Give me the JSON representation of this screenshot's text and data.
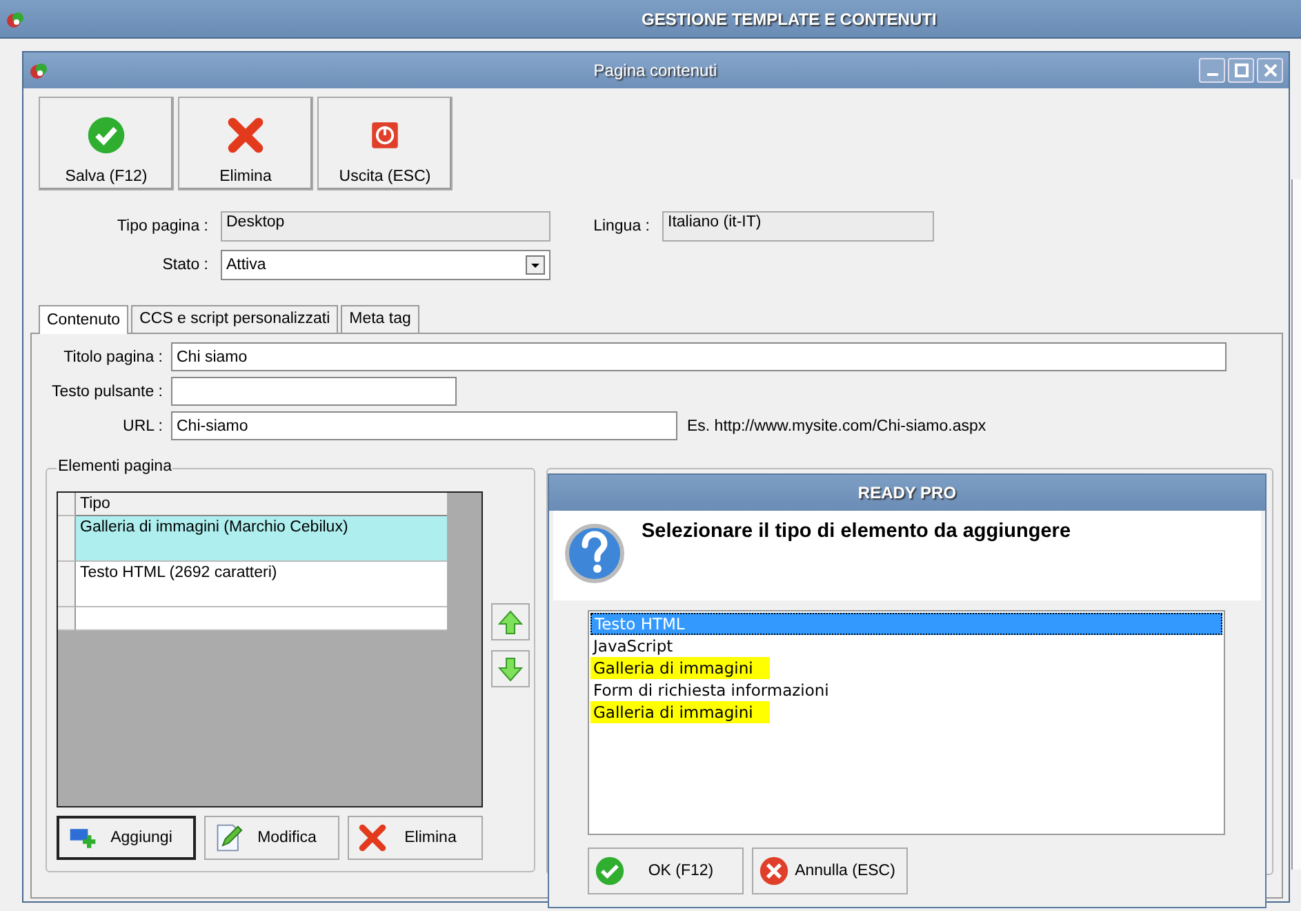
{
  "app_window": {
    "title": "GESTIONE TEMPLATE E CONTENUTI"
  },
  "window": {
    "title": "Pagina contenuti"
  },
  "toolbar": [
    {
      "label": "Salva (F12)",
      "kind": "save"
    },
    {
      "label": "Elimina",
      "kind": "delete"
    },
    {
      "label": "Uscita (ESC)",
      "kind": "exit"
    }
  ],
  "header_fields": [
    {
      "label": "Tipo pagina :",
      "value": "Desktop",
      "kind": "readonly"
    },
    {
      "label": "Lingua :",
      "value": "Italiano (it-IT)",
      "kind": "readonly"
    },
    {
      "label": "Stato :",
      "value": "Attiva",
      "kind": "select"
    }
  ],
  "tabs": [
    {
      "label": "Contenuto",
      "selected": true
    },
    {
      "label": "CCS e script personalizzati",
      "selected": false
    },
    {
      "label": "Meta tag",
      "selected": false
    }
  ],
  "content_fields": [
    {
      "label": "Titolo pagina :",
      "value": "Chi siamo"
    },
    {
      "label": "Testo pulsante :"
    },
    {
      "label": "URL :",
      "value": "Chi-siamo",
      "hint": "Es. http://www.mysite.com/Chi-siamo.aspx"
    }
  ],
  "elements_group": {
    "title": "Elementi pagina",
    "columns": [
      "Tipo"
    ],
    "rows": [
      {
        "text": "Galleria di immagini (Marchio Cebilux)",
        "selected": true
      },
      {
        "text": "Testo HTML (2692 caratteri)",
        "selected": false
      }
    ],
    "buttons": [
      {
        "label": "Aggiungi",
        "kind": "add",
        "focused": true
      },
      {
        "label": "Modifica",
        "kind": "edit",
        "focused": false
      },
      {
        "label": "Elimina",
        "kind": "delete",
        "focused": false
      }
    ]
  },
  "dialog": {
    "title": "READY PRO",
    "message": "Selezionare il tipo di elemento da aggiungere",
    "options": [
      {
        "text": "Testo HTML",
        "selected": true,
        "highlighted": false
      },
      {
        "text": "JavaScript",
        "selected": false,
        "highlighted": false
      },
      {
        "text": "Galleria di immagini",
        "selected": false,
        "highlighted": true
      },
      {
        "text": "Form di richiesta informazioni",
        "selected": false,
        "highlighted": false
      },
      {
        "text": "Galleria di immagini",
        "selected": false,
        "highlighted": true
      }
    ],
    "buttons": [
      {
        "label": "OK (F12)",
        "kind": "ok"
      },
      {
        "label": "Annulla (ESC)",
        "kind": "cancel"
      }
    ]
  }
}
